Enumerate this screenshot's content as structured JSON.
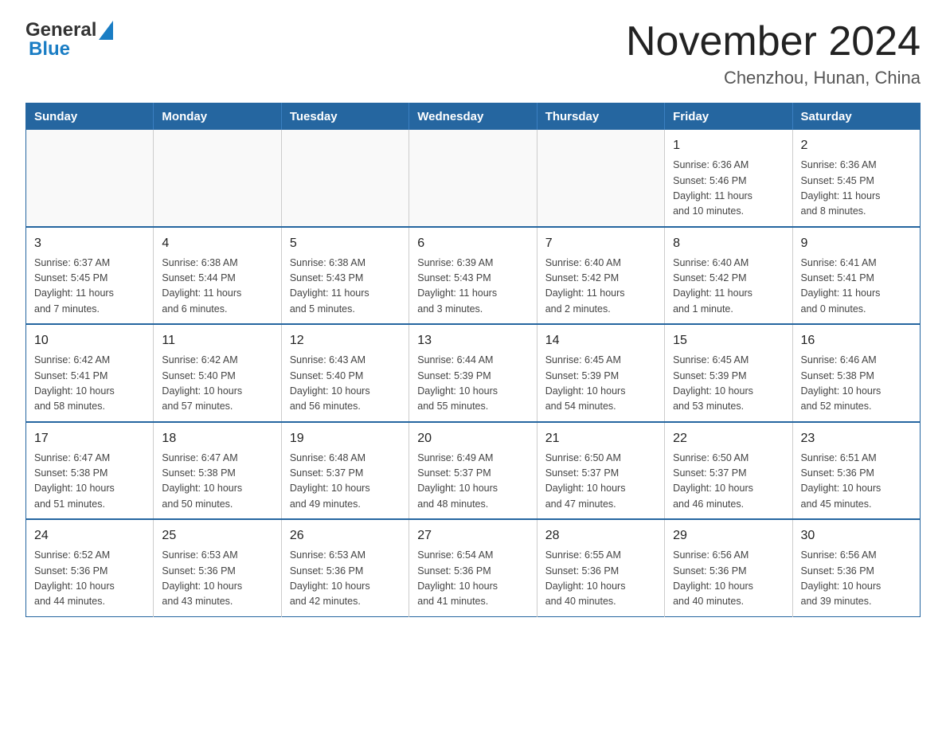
{
  "header": {
    "logo_general": "General",
    "logo_blue": "Blue",
    "month_title": "November 2024",
    "location": "Chenzhou, Hunan, China"
  },
  "weekdays": [
    "Sunday",
    "Monday",
    "Tuesday",
    "Wednesday",
    "Thursday",
    "Friday",
    "Saturday"
  ],
  "weeks": [
    [
      {
        "day": "",
        "info": ""
      },
      {
        "day": "",
        "info": ""
      },
      {
        "day": "",
        "info": ""
      },
      {
        "day": "",
        "info": ""
      },
      {
        "day": "",
        "info": ""
      },
      {
        "day": "1",
        "info": "Sunrise: 6:36 AM\nSunset: 5:46 PM\nDaylight: 11 hours\nand 10 minutes."
      },
      {
        "day": "2",
        "info": "Sunrise: 6:36 AM\nSunset: 5:45 PM\nDaylight: 11 hours\nand 8 minutes."
      }
    ],
    [
      {
        "day": "3",
        "info": "Sunrise: 6:37 AM\nSunset: 5:45 PM\nDaylight: 11 hours\nand 7 minutes."
      },
      {
        "day": "4",
        "info": "Sunrise: 6:38 AM\nSunset: 5:44 PM\nDaylight: 11 hours\nand 6 minutes."
      },
      {
        "day": "5",
        "info": "Sunrise: 6:38 AM\nSunset: 5:43 PM\nDaylight: 11 hours\nand 5 minutes."
      },
      {
        "day": "6",
        "info": "Sunrise: 6:39 AM\nSunset: 5:43 PM\nDaylight: 11 hours\nand 3 minutes."
      },
      {
        "day": "7",
        "info": "Sunrise: 6:40 AM\nSunset: 5:42 PM\nDaylight: 11 hours\nand 2 minutes."
      },
      {
        "day": "8",
        "info": "Sunrise: 6:40 AM\nSunset: 5:42 PM\nDaylight: 11 hours\nand 1 minute."
      },
      {
        "day": "9",
        "info": "Sunrise: 6:41 AM\nSunset: 5:41 PM\nDaylight: 11 hours\nand 0 minutes."
      }
    ],
    [
      {
        "day": "10",
        "info": "Sunrise: 6:42 AM\nSunset: 5:41 PM\nDaylight: 10 hours\nand 58 minutes."
      },
      {
        "day": "11",
        "info": "Sunrise: 6:42 AM\nSunset: 5:40 PM\nDaylight: 10 hours\nand 57 minutes."
      },
      {
        "day": "12",
        "info": "Sunrise: 6:43 AM\nSunset: 5:40 PM\nDaylight: 10 hours\nand 56 minutes."
      },
      {
        "day": "13",
        "info": "Sunrise: 6:44 AM\nSunset: 5:39 PM\nDaylight: 10 hours\nand 55 minutes."
      },
      {
        "day": "14",
        "info": "Sunrise: 6:45 AM\nSunset: 5:39 PM\nDaylight: 10 hours\nand 54 minutes."
      },
      {
        "day": "15",
        "info": "Sunrise: 6:45 AM\nSunset: 5:39 PM\nDaylight: 10 hours\nand 53 minutes."
      },
      {
        "day": "16",
        "info": "Sunrise: 6:46 AM\nSunset: 5:38 PM\nDaylight: 10 hours\nand 52 minutes."
      }
    ],
    [
      {
        "day": "17",
        "info": "Sunrise: 6:47 AM\nSunset: 5:38 PM\nDaylight: 10 hours\nand 51 minutes."
      },
      {
        "day": "18",
        "info": "Sunrise: 6:47 AM\nSunset: 5:38 PM\nDaylight: 10 hours\nand 50 minutes."
      },
      {
        "day": "19",
        "info": "Sunrise: 6:48 AM\nSunset: 5:37 PM\nDaylight: 10 hours\nand 49 minutes."
      },
      {
        "day": "20",
        "info": "Sunrise: 6:49 AM\nSunset: 5:37 PM\nDaylight: 10 hours\nand 48 minutes."
      },
      {
        "day": "21",
        "info": "Sunrise: 6:50 AM\nSunset: 5:37 PM\nDaylight: 10 hours\nand 47 minutes."
      },
      {
        "day": "22",
        "info": "Sunrise: 6:50 AM\nSunset: 5:37 PM\nDaylight: 10 hours\nand 46 minutes."
      },
      {
        "day": "23",
        "info": "Sunrise: 6:51 AM\nSunset: 5:36 PM\nDaylight: 10 hours\nand 45 minutes."
      }
    ],
    [
      {
        "day": "24",
        "info": "Sunrise: 6:52 AM\nSunset: 5:36 PM\nDaylight: 10 hours\nand 44 minutes."
      },
      {
        "day": "25",
        "info": "Sunrise: 6:53 AM\nSunset: 5:36 PM\nDaylight: 10 hours\nand 43 minutes."
      },
      {
        "day": "26",
        "info": "Sunrise: 6:53 AM\nSunset: 5:36 PM\nDaylight: 10 hours\nand 42 minutes."
      },
      {
        "day": "27",
        "info": "Sunrise: 6:54 AM\nSunset: 5:36 PM\nDaylight: 10 hours\nand 41 minutes."
      },
      {
        "day": "28",
        "info": "Sunrise: 6:55 AM\nSunset: 5:36 PM\nDaylight: 10 hours\nand 40 minutes."
      },
      {
        "day": "29",
        "info": "Sunrise: 6:56 AM\nSunset: 5:36 PM\nDaylight: 10 hours\nand 40 minutes."
      },
      {
        "day": "30",
        "info": "Sunrise: 6:56 AM\nSunset: 5:36 PM\nDaylight: 10 hours\nand 39 minutes."
      }
    ]
  ]
}
